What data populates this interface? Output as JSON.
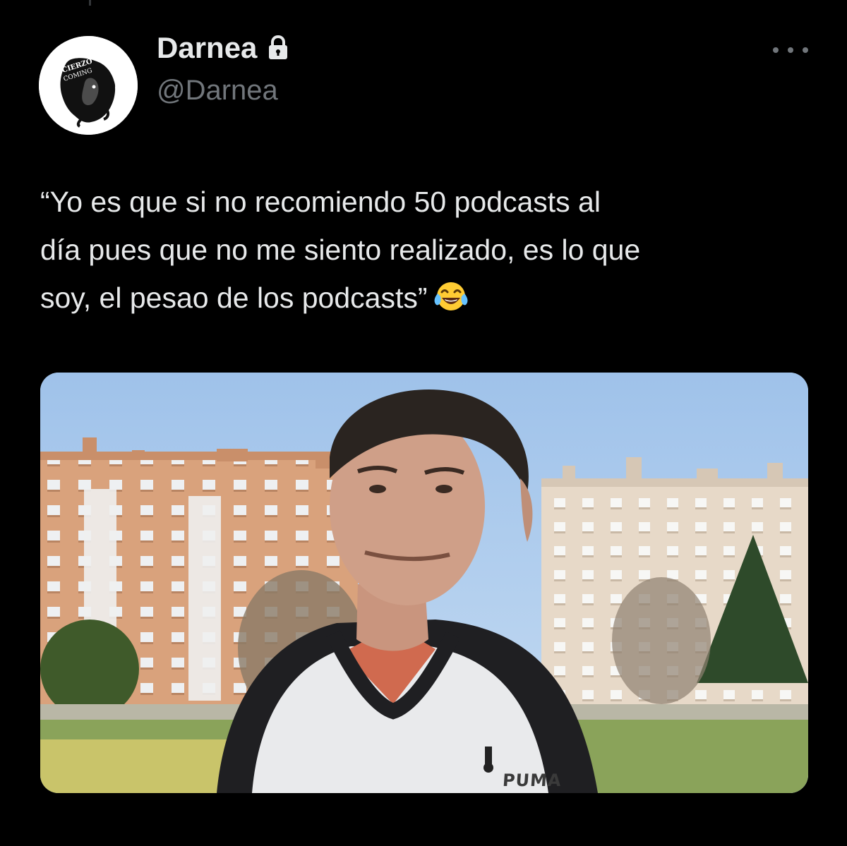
{
  "tweet": {
    "author": {
      "display_name": "Darnea",
      "handle": "@Darnea",
      "avatar_icon": "lion-logo-icon",
      "avatar_logo_text": "CIERZO COMING",
      "protected_icon": "lock-icon"
    },
    "menu_icon": "more-dots-icon",
    "text_lines": [
      "“Yo es que si no recomiendo 50 podcasts al",
      "día pues que no me siento realizado, es lo que",
      "soy, el pesao de los podcasts”"
    ],
    "emoji": "face-with-tears-of-joy",
    "media": {
      "description_icon": "photo-man-in-park-icon",
      "jacket_brand_text": "PUMA"
    }
  },
  "colors": {
    "background": "#000000",
    "primary_text": "#e7e9ea",
    "secondary_text": "#71767b"
  }
}
